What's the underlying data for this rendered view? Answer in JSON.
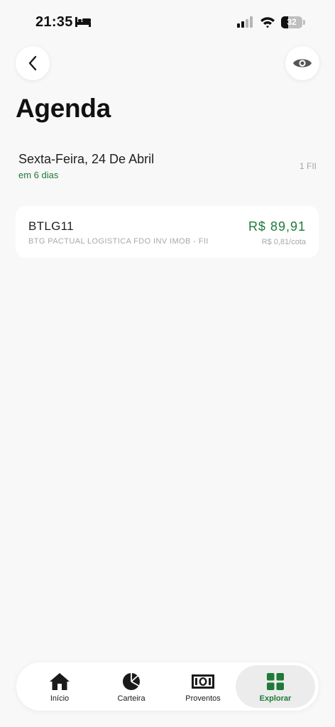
{
  "status_bar": {
    "time": "21:35",
    "battery_level": "32",
    "battery_fraction": 0.32,
    "icons": [
      "bed-icon",
      "signal-icon",
      "wifi-icon",
      "battery-icon"
    ]
  },
  "header": {
    "back_icon": "chevron-left-icon",
    "visibility_icon": "eye-icon",
    "title": "Agenda"
  },
  "schedule": {
    "date_label": "Sexta-Feira, 24 De Abril",
    "relative": "em 6 dias",
    "count": "1 FII",
    "items": [
      {
        "ticker": "BTLG11",
        "name": "BTG PACTUAL LOGISTICA FDO INV IMOB - FII",
        "amount": "R$ 89,91",
        "per_share": "R$ 0,81/cota"
      }
    ]
  },
  "tab_bar": {
    "tabs": [
      {
        "label": "Início",
        "icon": "home-icon"
      },
      {
        "label": "Carteira",
        "icon": "pie-chart-icon"
      },
      {
        "label": "Proventos",
        "icon": "banknote-icon"
      },
      {
        "label": "Explorar",
        "icon": "grid-icon",
        "active": true
      }
    ]
  },
  "colors": {
    "accent": "#1e7a37",
    "background": "#f7f8f7",
    "card": "#ffffff",
    "muted_text": "#a8a8a8"
  }
}
